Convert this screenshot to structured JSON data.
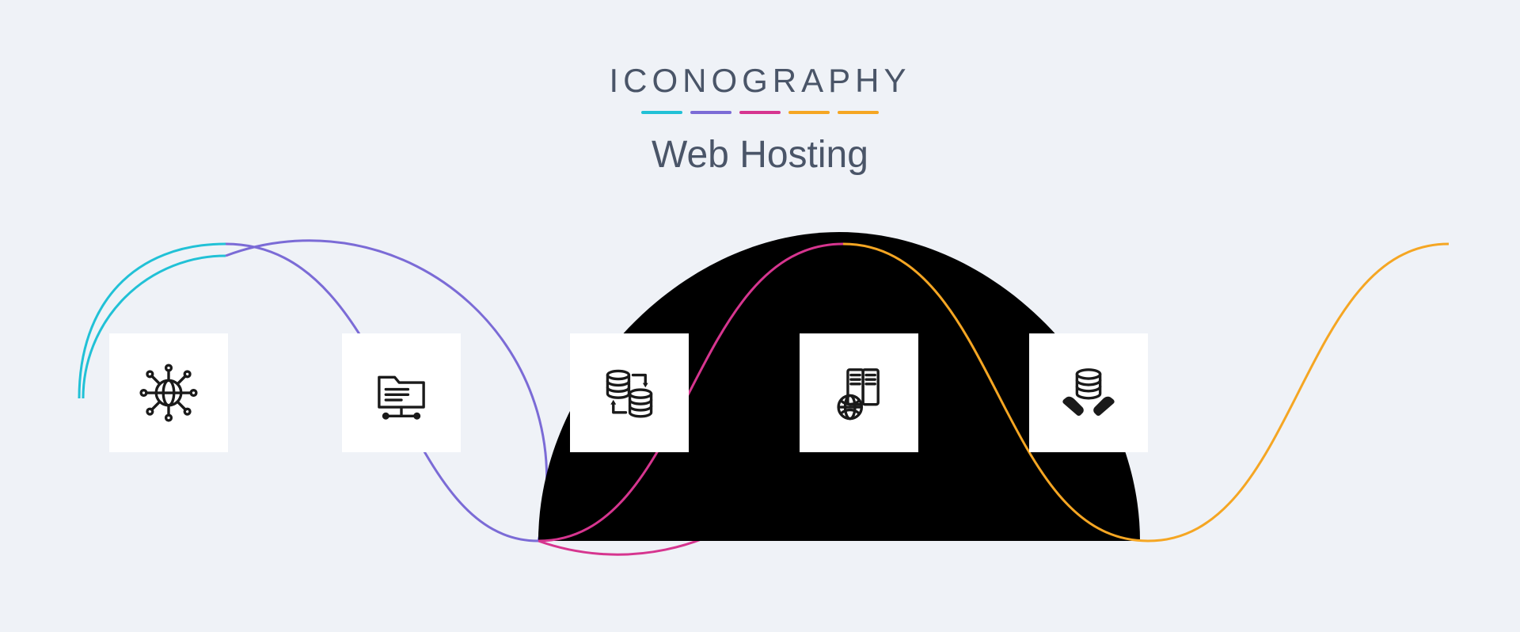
{
  "header": {
    "brand": "ICONOGRAPHY",
    "subtitle": "Web Hosting"
  },
  "palette": {
    "cyan": "#21c1d6",
    "purple": "#7b6bd6",
    "magenta": "#d6358f",
    "orange": "#f5a623"
  },
  "icons": [
    {
      "id": "globe-network",
      "label": "Global Network"
    },
    {
      "id": "folder-share",
      "label": "Shared Folder"
    },
    {
      "id": "database-sync",
      "label": "Database Sync"
    },
    {
      "id": "global-server",
      "label": "Global Server"
    },
    {
      "id": "database-care",
      "label": "Managed Database"
    }
  ]
}
